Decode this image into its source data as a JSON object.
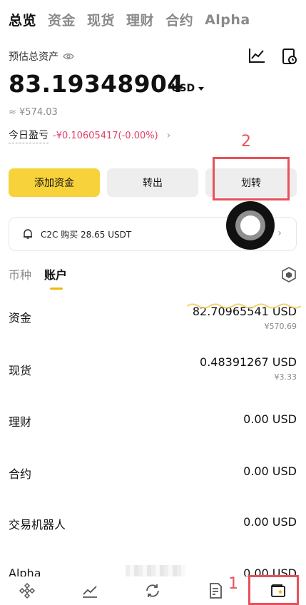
{
  "top_tabs": [
    "总览",
    "资金",
    "现货",
    "理财",
    "合约",
    "Alpha"
  ],
  "header": {
    "est_label": "预估总资产",
    "balance": "83.19348904",
    "currency": "USD",
    "approx": "≈ ¥574.03",
    "pnl_label": "今日盈亏",
    "pnl_value": "-¥0.10605417(-0.00%)"
  },
  "actions": {
    "deposit": "添加资金",
    "withdraw": "转出",
    "transfer": "划转"
  },
  "annotations": {
    "label_1": "1",
    "label_2": "2"
  },
  "c2c": {
    "text": "C2C 购买 28.65 USDT"
  },
  "sub_tabs": [
    "币种",
    "账户"
  ],
  "accounts": [
    {
      "name": "资金",
      "amount": "82.70965541 USD",
      "fiat": "¥570.69"
    },
    {
      "name": "现货",
      "amount": "0.48391267 USD",
      "fiat": "¥3.33"
    },
    {
      "name": "理财",
      "amount": "0.00 USD",
      "fiat": ""
    },
    {
      "name": "合约",
      "amount": "0.00 USD",
      "fiat": ""
    },
    {
      "name": "交易机器人",
      "amount": "0.00 USD",
      "fiat": ""
    },
    {
      "name": "Alpha",
      "amount": "0.00 USD",
      "fiat": ""
    }
  ],
  "colors": {
    "accent": "#f7d23a",
    "negative": "#e0426a",
    "annotation": "#e8505b",
    "tab_underline": "#f0b90b"
  },
  "nav_icons": [
    "binance-home-icon",
    "markets-icon",
    "trade-icon",
    "orders-icon",
    "wallet-icon"
  ]
}
